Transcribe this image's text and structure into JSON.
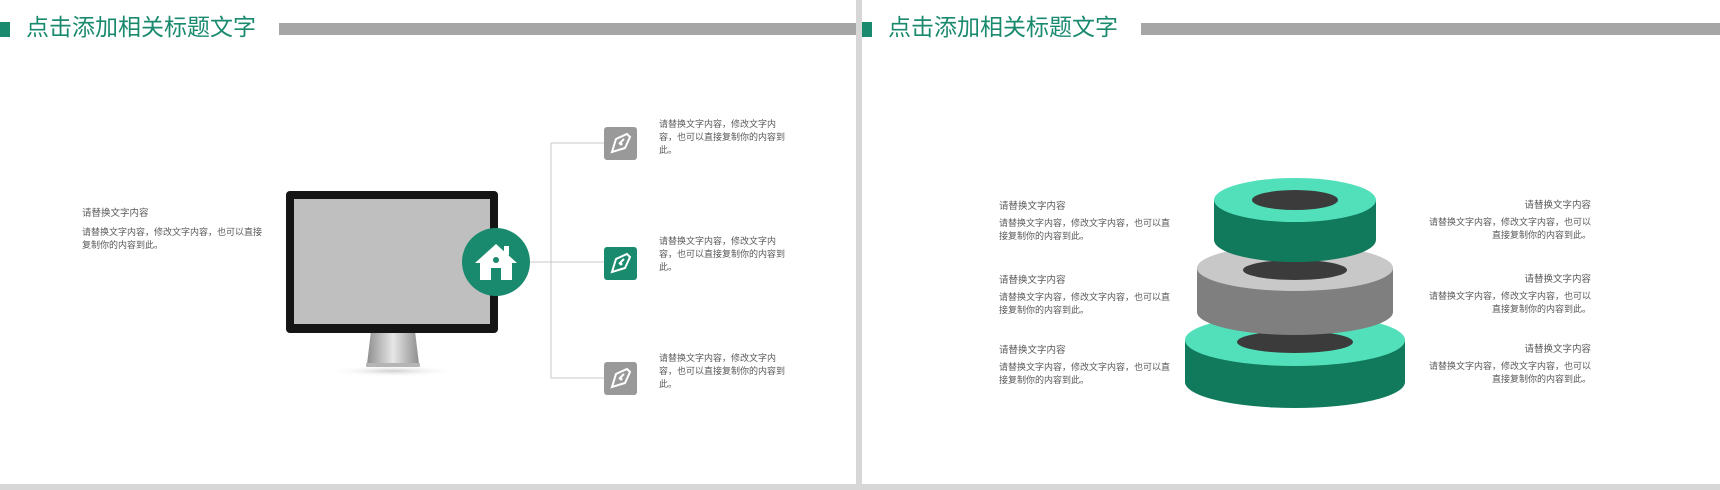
{
  "colors": {
    "accent": "#1a8a6f",
    "dark_green": "#127a5c",
    "mint": "#52e0bb",
    "gray": "#999999",
    "text": "#595959"
  },
  "left_slide": {
    "title": "点击添加相关标题文字",
    "intro": {
      "heading": "请替换文字内容",
      "body": "请替换文字内容，修改文字内容，也可以直接复制你的内容到此。"
    },
    "center_icon": "home-icon",
    "items": [
      {
        "icon": "pen-icon",
        "text": "请替换文字内容，修改文字内容，也可以直接复制你的内容到此。"
      },
      {
        "icon": "pen-icon",
        "text": "请替换文字内容，修改文字内容，也可以直接复制你的内容到此。"
      },
      {
        "icon": "pen-icon",
        "text": "请替换文字内容，修改文字内容，也可以直接复制你的内容到此。"
      }
    ]
  },
  "right_slide": {
    "title": "点击添加相关标题文字",
    "left_items": [
      {
        "heading": "请替换文字内容",
        "body": "请替换文字内容，修改文字内容，也可以直接复制你的内容到此。"
      },
      {
        "heading": "请替换文字内容",
        "body": "请替换文字内容，修改文字内容，也可以直接复制你的内容到此。"
      },
      {
        "heading": "请替换文字内容",
        "body": "请替换文字内容，修改文字内容，也可以直接复制你的内容到此。"
      }
    ],
    "right_items": [
      {
        "heading": "请替换文字内容",
        "body": "请替换文字内容，修改文字内容，也可以直接复制你的内容到此。"
      },
      {
        "heading": "请替换文字内容",
        "body": "请替换文字内容，修改文字内容，也可以直接复制你的内容到此。"
      },
      {
        "heading": "请替换文字内容",
        "body": "请替换文字内容，修改文字内容，也可以直接复制你的内容到此。"
      }
    ]
  }
}
